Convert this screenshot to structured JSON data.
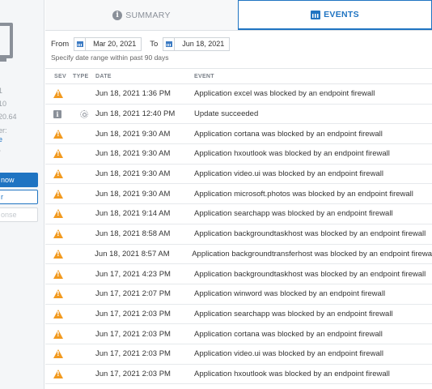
{
  "sidebar": {
    "meta_lines": [
      "1",
      "10",
      "20.64",
      "er:",
      "e",
      "/"
    ],
    "buttons": {
      "primary": "now",
      "outline": "r",
      "disabled": "onse"
    }
  },
  "tabs": [
    {
      "label": "SUMMARY",
      "icon": "info-icon",
      "active": false
    },
    {
      "label": "EVENTS",
      "icon": "calendar-icon",
      "active": true
    }
  ],
  "filter": {
    "from_label": "From",
    "from_value": "Mar 20, 2021",
    "to_label": "To",
    "to_value": "Jun 18, 2021",
    "hint": "Specify date range within past 90 days"
  },
  "table": {
    "headers": {
      "sev": "SEV",
      "type": "TYPE",
      "date": "DATE",
      "event": "EVENT"
    },
    "rows": [
      {
        "sev": "warning",
        "type": "",
        "date": "Jun 18, 2021 1:36 PM",
        "event": "Application excel was blocked by an endpoint firewall"
      },
      {
        "sev": "info",
        "type": "gear",
        "date": "Jun 18, 2021 12:40 PM",
        "event": "Update succeeded"
      },
      {
        "sev": "warning",
        "type": "",
        "date": "Jun 18, 2021 9:30 AM",
        "event": "Application cortana was blocked by an endpoint firewall"
      },
      {
        "sev": "warning",
        "type": "",
        "date": "Jun 18, 2021 9:30 AM",
        "event": "Application hxoutlook was blocked by an endpoint firewall"
      },
      {
        "sev": "warning",
        "type": "",
        "date": "Jun 18, 2021 9:30 AM",
        "event": "Application video.ui was blocked by an endpoint firewall"
      },
      {
        "sev": "warning",
        "type": "",
        "date": "Jun 18, 2021 9:30 AM",
        "event": "Application microsoft.photos was blocked by an endpoint firewall"
      },
      {
        "sev": "warning",
        "type": "",
        "date": "Jun 18, 2021 9:14 AM",
        "event": "Application searchapp was blocked by an endpoint firewall"
      },
      {
        "sev": "warning",
        "type": "",
        "date": "Jun 18, 2021 8:58 AM",
        "event": "Application backgroundtaskhost was blocked by an endpoint firewall"
      },
      {
        "sev": "warning",
        "type": "",
        "date": "Jun 18, 2021 8:57 AM",
        "event": "Application backgroundtransferhost was blocked by an endpoint firewa"
      },
      {
        "sev": "warning",
        "type": "",
        "date": "Jun 17, 2021 4:23 PM",
        "event": "Application backgroundtaskhost was blocked by an endpoint firewall"
      },
      {
        "sev": "warning",
        "type": "",
        "date": "Jun 17, 2021 2:07 PM",
        "event": "Application winword was blocked by an endpoint firewall"
      },
      {
        "sev": "warning",
        "type": "",
        "date": "Jun 17, 2021 2:03 PM",
        "event": "Application searchapp was blocked by an endpoint firewall"
      },
      {
        "sev": "warning",
        "type": "",
        "date": "Jun 17, 2021 2:03 PM",
        "event": "Application cortana was blocked by an endpoint firewall"
      },
      {
        "sev": "warning",
        "type": "",
        "date": "Jun 17, 2021 2:03 PM",
        "event": "Application video.ui was blocked by an endpoint firewall"
      },
      {
        "sev": "warning",
        "type": "",
        "date": "Jun 17, 2021 2:03 PM",
        "event": "Application hxoutlook was blocked by an endpoint firewall"
      }
    ]
  },
  "colors": {
    "accent": "#1f74c2",
    "warning": "#f29a1f",
    "muted": "#8a9099"
  }
}
